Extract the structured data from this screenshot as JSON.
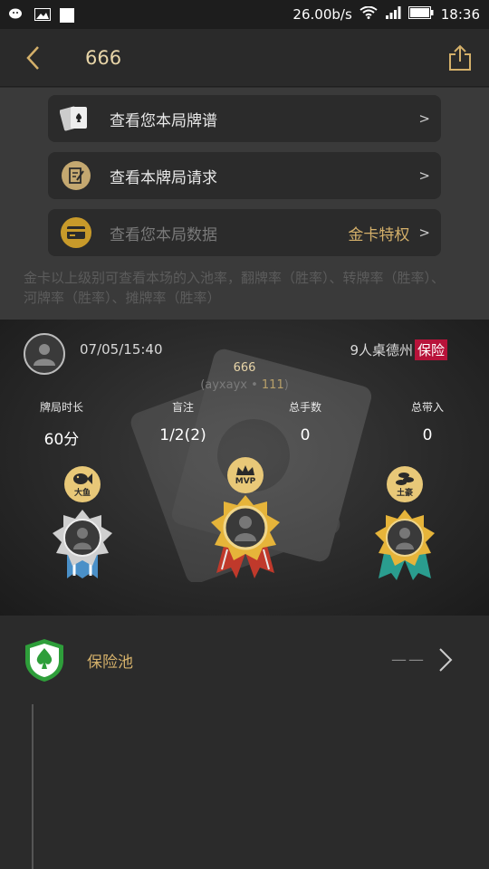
{
  "status_bar": {
    "speed": "26.00b/s",
    "time": "18:36",
    "icons": [
      "wechat-icon",
      "image-icon",
      "square-icon",
      "wifi-icon",
      "signal-icon",
      "battery-icon"
    ]
  },
  "nav": {
    "title": "666",
    "back_icon": "chevron-left-icon",
    "share_icon": "share-icon"
  },
  "menu": {
    "items": [
      {
        "label": "查看您本局牌谱",
        "right": ">",
        "icon": "cards-icon"
      },
      {
        "label": "查看本牌局请求",
        "right": ">",
        "icon": "edit-request-icon"
      },
      {
        "label": "查看您本局数据",
        "badge": "金卡特权",
        "right": ">",
        "icon": "gold-card-icon"
      }
    ],
    "tip": "金卡以上级别可查看本场的入池率，翻牌率（胜率）、转牌率（胜率）、河牌率（胜率）、摊牌率（胜率）"
  },
  "card": {
    "date": "07/05/15:40",
    "table": "9人桌德州",
    "insurance_badge": "保险",
    "name": "666",
    "sub_prefix": "(ayxayx • ",
    "sub_num": "111",
    "sub_suffix": ")",
    "stats": [
      {
        "label": "牌局时长",
        "value": "60分"
      },
      {
        "label": "盲注",
        "value": "1/2(2)"
      },
      {
        "label": "总手数",
        "value": "0"
      },
      {
        "label": "总带入",
        "value": "0"
      }
    ],
    "medals": [
      {
        "title": "大鱼",
        "icon": "fish-icon",
        "ribbon_color": "#4a90c8"
      },
      {
        "title": "MVP",
        "icon": "crown-icon",
        "ribbon_color": "#c0392b"
      },
      {
        "title": "土豪",
        "icon": "coins-icon",
        "ribbon_color": "#2a9d8f"
      }
    ]
  },
  "insurance": {
    "label": "保险池",
    "value": "——",
    "icon": "spade-shield-icon"
  }
}
